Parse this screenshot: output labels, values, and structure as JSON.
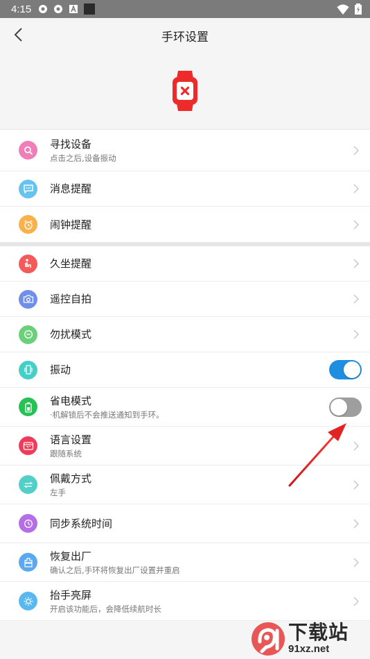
{
  "status_bar": {
    "time": "4:15"
  },
  "header": {
    "title": "手环设置"
  },
  "colors": {
    "device": "#ee2b2b",
    "toggle_on": "#1e8fe0",
    "toggle_off": "#9e9e9e",
    "arrow": "#d62020"
  },
  "settings": {
    "find_device": {
      "label": "寻找设备",
      "sub": "点击之后,设备振动",
      "icon": "search-icon",
      "color": "#f07fb8"
    },
    "message_reminder": {
      "label": "消息提醒",
      "icon": "chat-icon",
      "color": "#66c3f0"
    },
    "alarm_reminder": {
      "label": "闹钟提醒",
      "icon": "alarm-icon",
      "color": "#fbb14a"
    },
    "sedentary_reminder": {
      "label": "久坐提醒",
      "icon": "sitting-icon",
      "color": "#f45a5a"
    },
    "remote_selfie": {
      "label": "遥控自拍",
      "icon": "camera-icon",
      "color": "#6f8fe8"
    },
    "do_not_disturb": {
      "label": "勿扰模式",
      "icon": "dnd-icon",
      "color": "#6bd07a"
    },
    "vibration": {
      "label": "振动",
      "icon": "phone-vibrate-icon",
      "color": "#45cfc8",
      "enabled": true
    },
    "power_saving": {
      "label": "省电模式",
      "sub": "·机解锁后不会推送通知到手环。",
      "icon": "battery-icon",
      "color": "#27c255",
      "enabled": false
    },
    "language": {
      "label": "语言设置",
      "sub": "跟随系统",
      "icon": "language-icon",
      "color": "#f03c5a"
    },
    "wearing_mode": {
      "label": "佩戴方式",
      "sub": "左手",
      "icon": "swap-icon",
      "color": "#52cfc6"
    },
    "sync_time": {
      "label": "同步系统时间",
      "icon": "clock-icon",
      "color": "#b56ee6"
    },
    "factory_reset": {
      "label": "恢复出厂",
      "sub": "确认之后,手环将恢复出厂设置并重启",
      "icon": "reset-icon",
      "color": "#5aa8ee"
    },
    "raise_to_wake": {
      "label": "抬手亮屏",
      "sub": "开启该功能后，会降低续航时长",
      "icon": "sun-icon",
      "color": "#5ab8f0"
    }
  },
  "watermark": {
    "title": "下载站",
    "url": "91xz.net"
  }
}
